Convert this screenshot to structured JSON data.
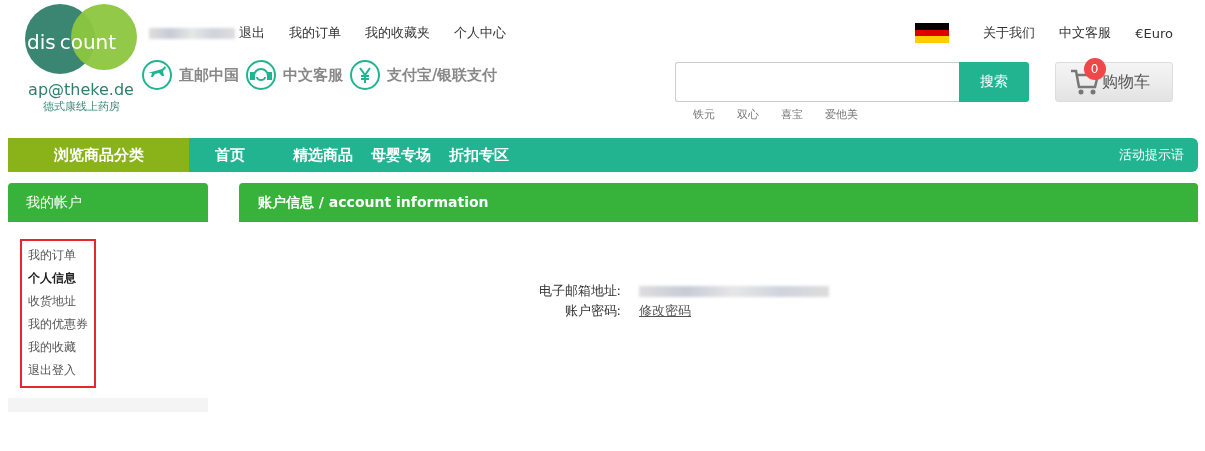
{
  "logo": {
    "word_left": "dis",
    "word_right": "count",
    "domain": "ap@theke.de",
    "tagline": "德式康线上药房"
  },
  "user_links": [
    {
      "label": "退出"
    },
    {
      "label": "我的订单"
    },
    {
      "label": "我的收藏夹"
    },
    {
      "label": "个人中心"
    }
  ],
  "services": [
    {
      "kind": "plane",
      "label": "直邮中国"
    },
    {
      "kind": "headset",
      "label": "中文客服"
    },
    {
      "kind": "yen",
      "label": "支付宝/银联支付"
    }
  ],
  "top_right_links": [
    {
      "label": "关于我们"
    },
    {
      "label": "中文客服"
    },
    {
      "label": "€Euro"
    }
  ],
  "search": {
    "button": "搜索",
    "hot_keywords": [
      "铁元",
      "双心",
      "喜宝",
      "爱他美"
    ]
  },
  "cart": {
    "label": "购物车",
    "count": "0"
  },
  "nav": {
    "category_button": "浏览商品分类",
    "items": [
      {
        "label": "首页"
      },
      {
        "label": "精选商品"
      },
      {
        "label": "母婴专场"
      },
      {
        "label": "折扣专区"
      }
    ],
    "promo": "活动提示语"
  },
  "sidebar": {
    "title": "我的帐户",
    "items": [
      {
        "label": "我的订单",
        "selected": false
      },
      {
        "label": "个人信息",
        "selected": true
      },
      {
        "label": "收货地址",
        "selected": false
      },
      {
        "label": "我的优惠券",
        "selected": false
      },
      {
        "label": "我的收藏",
        "selected": false
      },
      {
        "label": "退出登入",
        "selected": false
      }
    ]
  },
  "main": {
    "title": "账户信息 / account information",
    "fields": [
      {
        "label": "电子邮箱地址:",
        "kind": "redacted"
      },
      {
        "label": "账户密码:",
        "kind": "link",
        "value": "修改密码"
      }
    ]
  }
}
